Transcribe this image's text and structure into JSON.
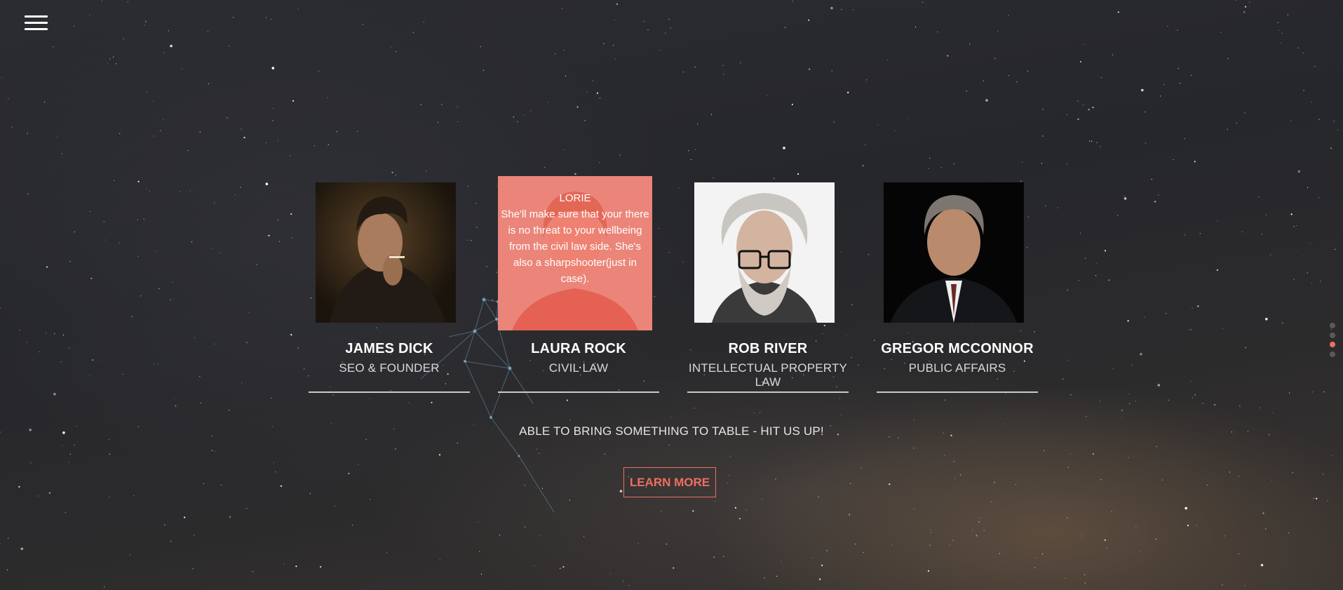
{
  "nav": {
    "menu_icon": "hamburger-icon"
  },
  "team": [
    {
      "name": "JAMES DICK",
      "role": "SEO & FOUNDER",
      "photo": "man-smoking-portrait"
    },
    {
      "name": "LAURA ROCK",
      "role": "CIVIL LAW",
      "photo": "woman-portrait",
      "overlay": {
        "nickname": "LORIE",
        "description": "She'll make sure that your there is no threat to your wellbeing from the civil law side. She's also a sharpshooter(just in case)."
      }
    },
    {
      "name": "ROB RIVER",
      "role": "INTELLECTUAL PROPERTY LAW",
      "photo": "old-man-glasses-portrait"
    },
    {
      "name": "GREGOR MCCONNOR",
      "role": "PUBLIC AFFAIRS",
      "photo": "man-suit-portrait"
    }
  ],
  "cta": {
    "text": "ABLE TO BRING SOMETHING TO TABLE - HIT US UP!",
    "button_label": "LEARN MORE"
  },
  "section_nav": {
    "dot_count": 4,
    "active_index": 2
  },
  "colors": {
    "accent": "#ef6e60",
    "text": "#ffffff",
    "underline": "#c9c9c9"
  }
}
